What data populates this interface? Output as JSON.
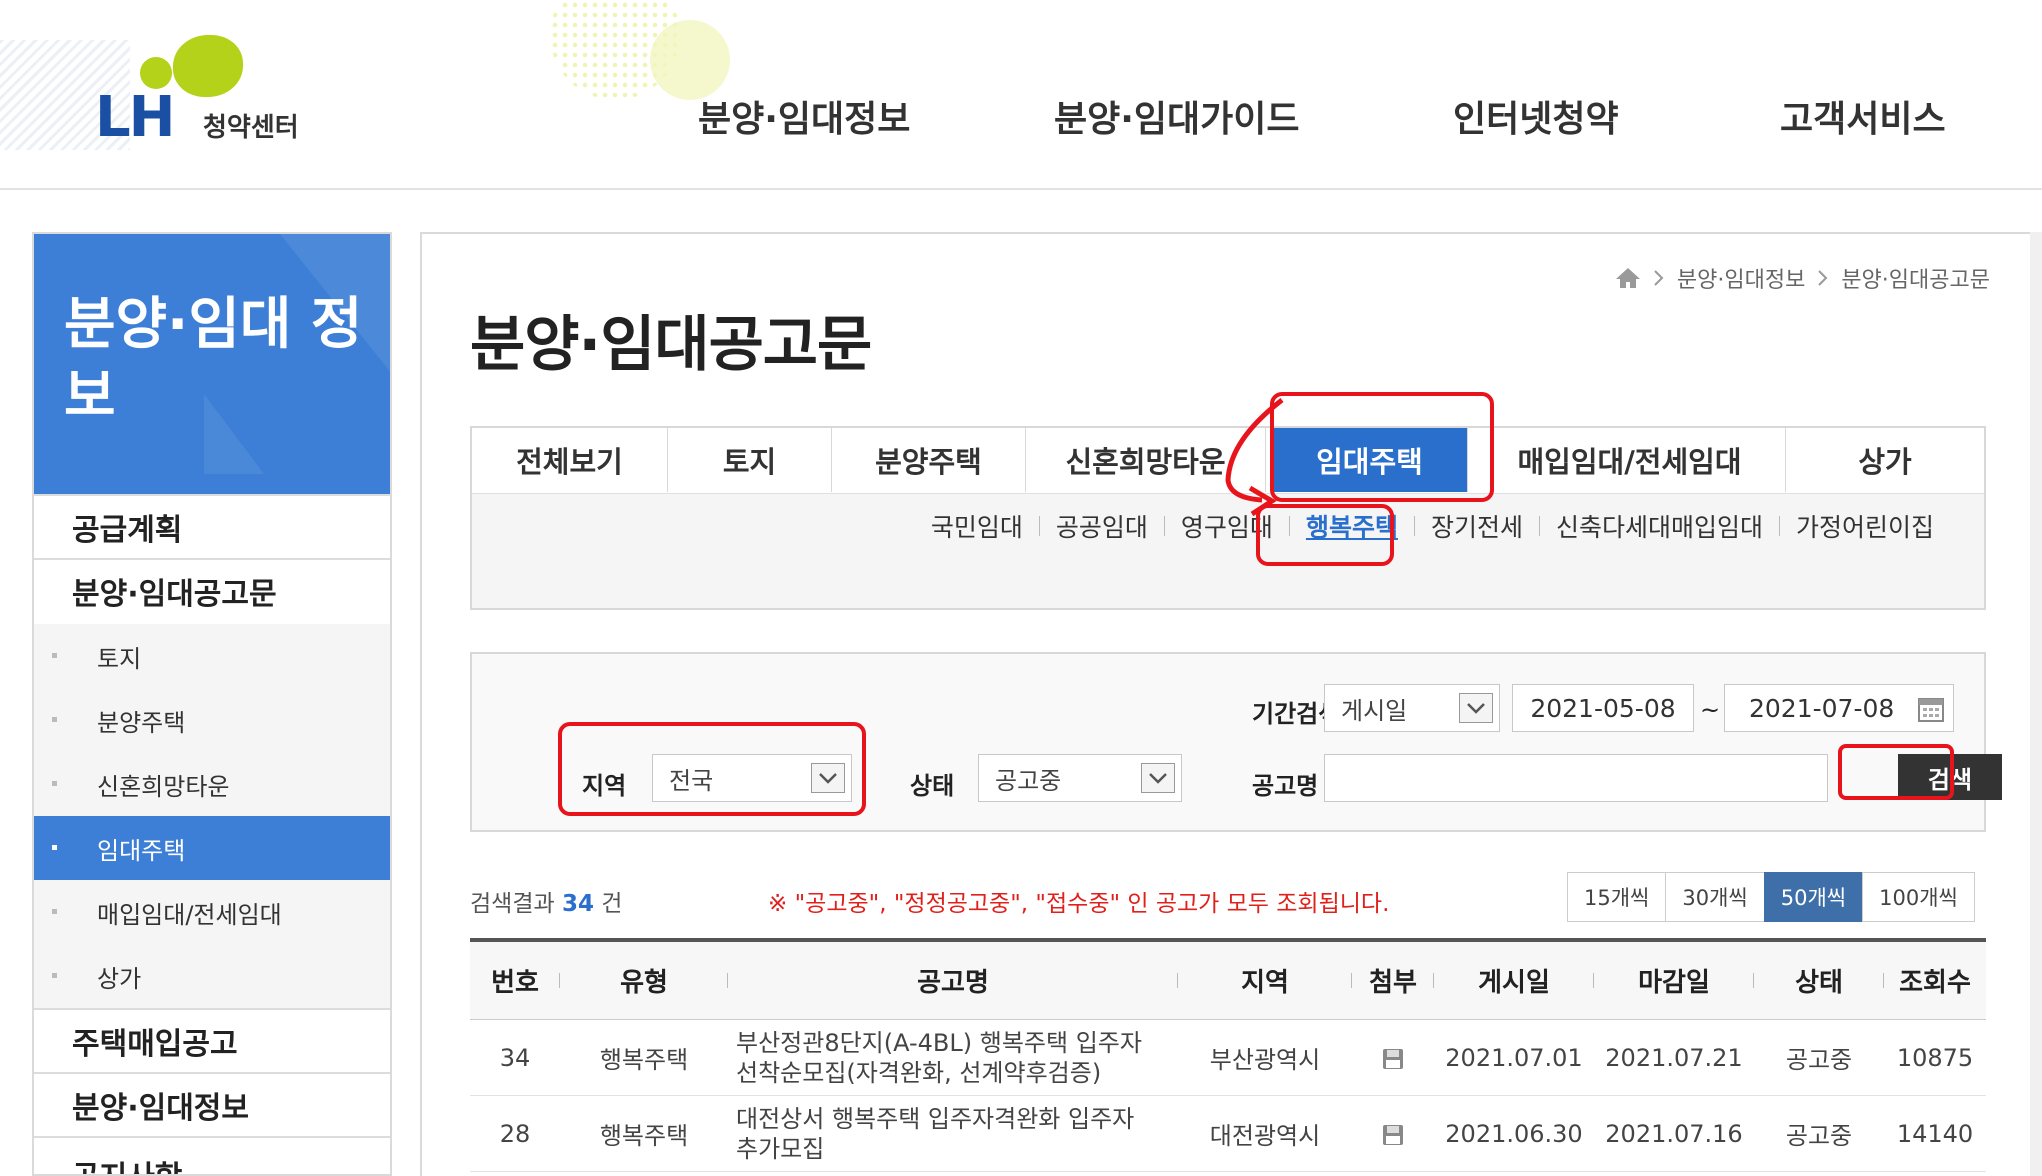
{
  "header": {
    "logo_text": "LH",
    "logo_sub": "청약센터",
    "gnb": [
      "분양·임대정보",
      "분양·임대가이드",
      "인터넷청약",
      "고객서비스"
    ]
  },
  "sidebar": {
    "title": "분양·임대 정보",
    "menus": {
      "supply_plan": "공급계획",
      "notice": "분양·임대공고문",
      "house_purchase": "주택매입공고",
      "info": "분양·임대정보",
      "news": "공지사항"
    },
    "subs": [
      "토지",
      "분양주택",
      "신혼희망타운",
      "임대주택",
      "매입임대/전세임대",
      "상가"
    ]
  },
  "breadcrumb": [
    "분양·임대정보",
    "분양·임대공고문"
  ],
  "page_title": "분양·임대공고문",
  "tabs": [
    "전체보기",
    "토지",
    "분양주택",
    "신혼희망타운",
    "임대주택",
    "매입임대/전세임대",
    "상가"
  ],
  "subtabs": [
    "국민임대",
    "공공임대",
    "영구임대",
    "행복주택",
    "장기전세",
    "신축다세대매입임대",
    "가정어린이집"
  ],
  "search": {
    "period_label": "기간검색",
    "period_type": "게시일",
    "date_from": "2021-05-08",
    "date_tilde": "~",
    "date_to": "2021-07-08",
    "region_label": "지역",
    "region_value": "전국",
    "status_label": "상태",
    "status_value": "공고중",
    "name_label": "공고명",
    "name_value": "",
    "search_button": "검색"
  },
  "result": {
    "prefix": "검색결과",
    "count": "34",
    "suffix": "건",
    "notice": "※ \"공고중\", \"정정공고중\", \"접수중\" 인 공고가 모두 조회됩니다."
  },
  "per_page": [
    "15개씩",
    "30개씩",
    "50개씩",
    "100개씩"
  ],
  "table": {
    "headers": [
      "번호",
      "유형",
      "공고명",
      "지역",
      "첨부",
      "게시일",
      "마감일",
      "상태",
      "조회수"
    ],
    "rows": [
      {
        "no": "34",
        "type": "행복주택",
        "title1": "부산정관8단지(A-4BL) 행복주택 입주자",
        "title2": "선착순모집(자격완화, 선계약후검증)",
        "region": "부산광역시",
        "posted": "2021.07.01",
        "deadline": "2021.07.21",
        "status": "공고중",
        "views": "10875"
      },
      {
        "no": "28",
        "type": "행복주택",
        "title1": "대전상서 행복주택 입주자격완화 입주자",
        "title2": "추가모집",
        "region": "대전광역시",
        "posted": "2021.06.30",
        "deadline": "2021.07.16",
        "status": "공고중",
        "views": "14140"
      }
    ]
  },
  "colors": {
    "accent": "#2b6fcd",
    "sidebar": "#3d7fd6",
    "logo_green": "#b5d21a",
    "annotation": "#e8141c"
  },
  "icons": [
    "home-icon",
    "chevron-right-icon",
    "chevron-down-icon",
    "calendar-icon",
    "disk-icon"
  ]
}
